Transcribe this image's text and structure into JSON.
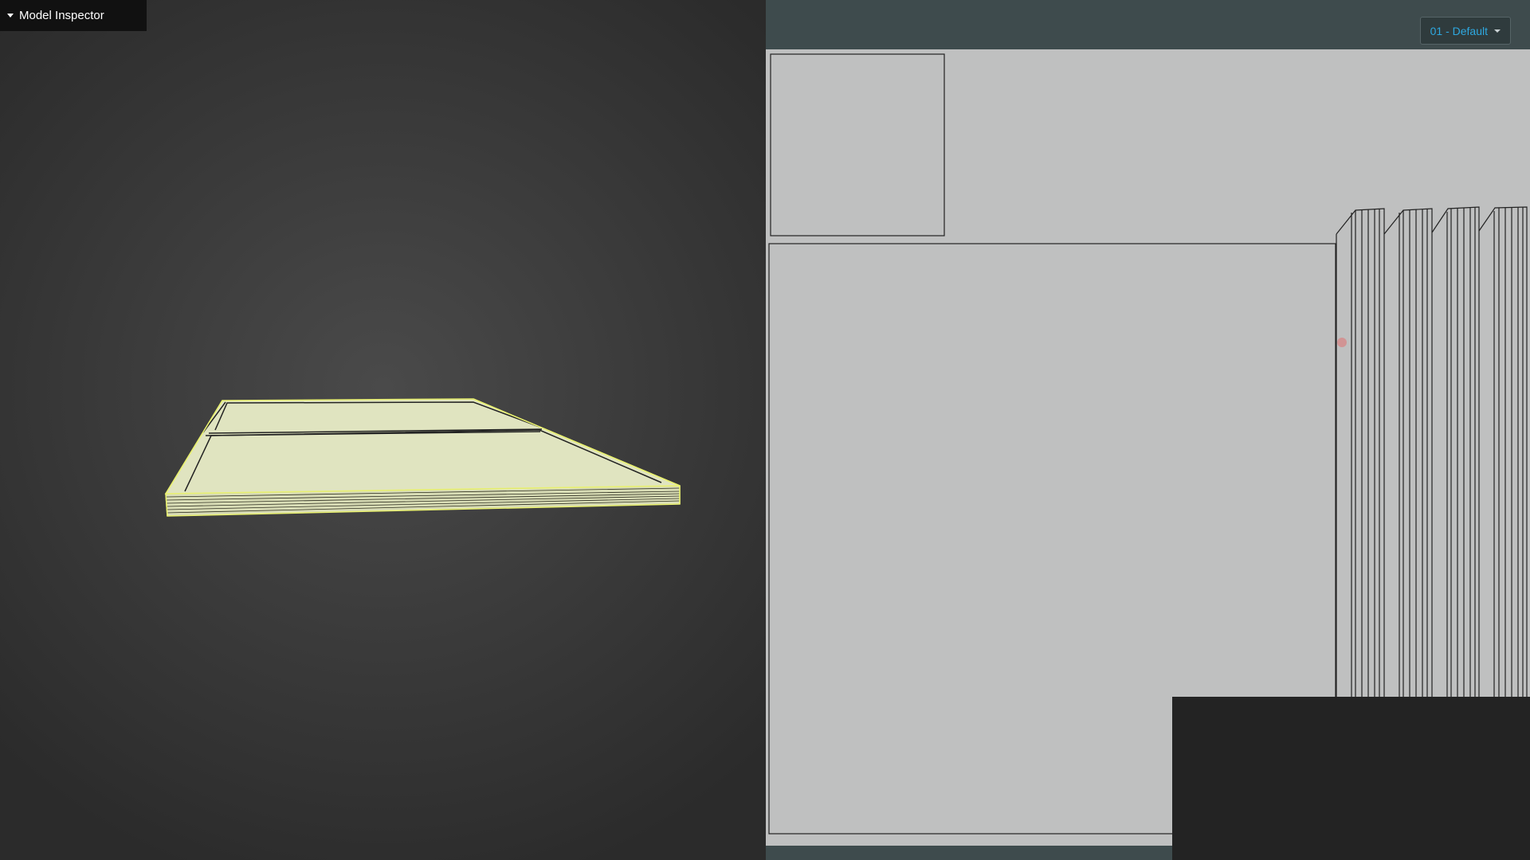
{
  "inspector": {
    "title": "Model Inspector"
  },
  "material_selector": {
    "selected": "01 - Default"
  },
  "colors": {
    "model_fill": "#e0e4c0",
    "model_edge": "#e8f070",
    "uv_background": "#bfc0c0",
    "toolbar": "#3e4b4d",
    "accent_text": "#2ea8e0"
  }
}
